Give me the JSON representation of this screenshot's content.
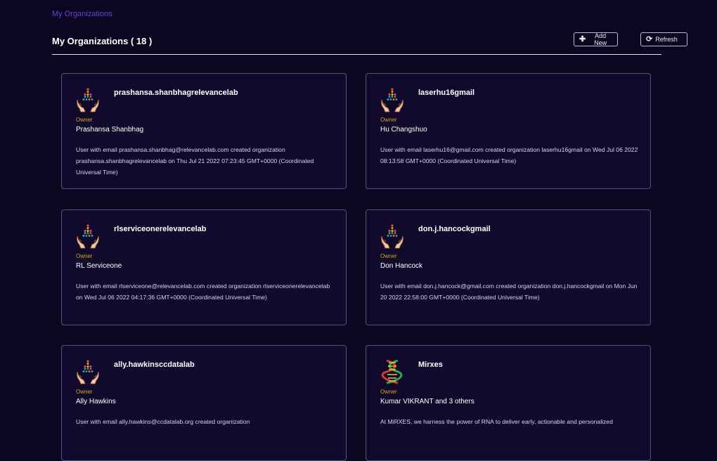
{
  "breadcrumb": "My Organizations",
  "header": {
    "title": "My Organizations ( 18 )",
    "add_label": "Add New",
    "refresh_label": "Refresh",
    "add_icon": "plus-icon",
    "refresh_icon": "refresh-icon"
  },
  "colors": {
    "background": "#0b0720",
    "card_background": "#120a2c",
    "card_border": "#57517a",
    "breadcrumb": "#6b3fe0",
    "role": "#d7a322"
  },
  "organizations": [
    {
      "name": "prashansa.shanbhagrelevancelab",
      "role": "Owner",
      "owner": "Prashansa Shanbhag",
      "description": "User with email prashansa.shanbhag@relevancelab.com created organization prashansa.shanbhagrelevancelab on Thu Jul 21 2022 07:23:45 GMT+0000 (Coordinated Universal Time)",
      "icon": "hands-people-icon"
    },
    {
      "name": "laserhu16gmail",
      "role": "Owner",
      "owner": "Hu Changshuo",
      "description": "User with email laserhu16@gmail.com created organization laserhu16gmail on Wed Jul 06 2022 08:13:58 GMT+0000 (Coordinated Universal Time)",
      "icon": "hands-people-icon"
    },
    {
      "name": "rlserviceonerelevancelab",
      "role": "Owner",
      "owner": "RL Serviceone",
      "description": "User with email rlserviceone@relevancelab.com created organization rlserviceonerelevancelab on Wed Jul 06 2022 04:17:36 GMT+0000 (Coordinated Universal Time)",
      "icon": "hands-people-icon"
    },
    {
      "name": "don.j.hancockgmail",
      "role": "Owner",
      "owner": "Don Hancock",
      "description": "User with email don.j.hancock@gmail.com created organization don.j.hancockgmail on Mon Jun 20 2022 22:58:00 GMT+0000 (Coordinated Universal Time)",
      "icon": "hands-people-icon"
    },
    {
      "name": "ally.hawkinsccdatalab",
      "role": "Owner",
      "owner": "Ally Hawkins",
      "description": "User with email ally.hawkins@ccdatalab.org created organization",
      "icon": "hands-people-icon"
    },
    {
      "name": "Mirxes",
      "role": "Owner",
      "owner": "Kumar VIKRANT and 3 others",
      "description": "At MiRXES, we harness the power of RNA to deliver early, actionable and personalized",
      "icon": "dna-icon"
    }
  ]
}
